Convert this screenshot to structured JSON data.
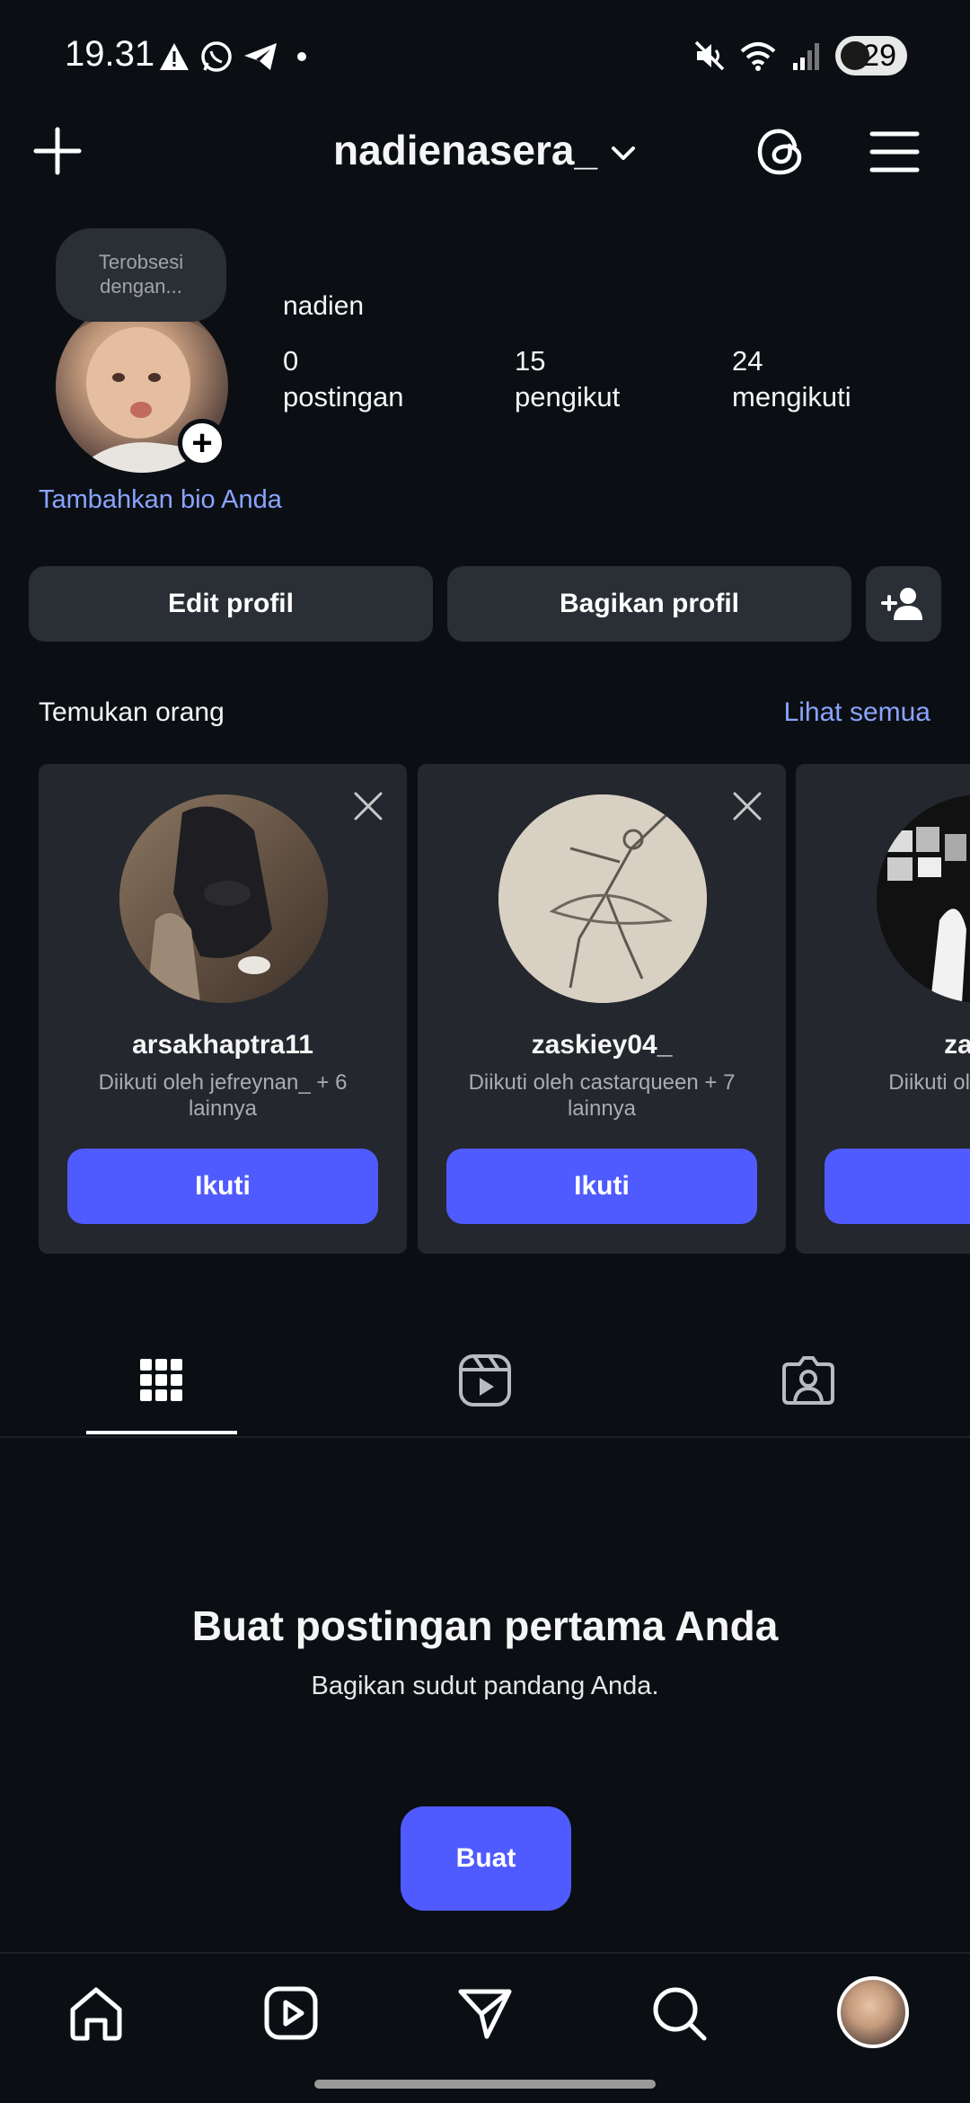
{
  "status_bar": {
    "time": "19.31",
    "battery": "29",
    "left_icons": [
      "warning-icon",
      "whatsapp-icon",
      "telegram-icon",
      "dot-icon"
    ],
    "right_icons": [
      "mute-icon",
      "wifi-icon",
      "signal-icon"
    ]
  },
  "header": {
    "username": "nadienasera_"
  },
  "profile": {
    "note": "Terobsesi dengan...",
    "display_name": "nadien",
    "stats": [
      {
        "value": "0",
        "label": "postingan"
      },
      {
        "value": "15",
        "label": "pengikut"
      },
      {
        "value": "24",
        "label": "mengikuti"
      }
    ],
    "add_bio": "Tambahkan bio Anda"
  },
  "actions": {
    "edit": "Edit profil",
    "share": "Bagikan profil"
  },
  "discover": {
    "title": "Temukan orang",
    "see_all": "Lihat semua",
    "cards": [
      {
        "name": "arsakhaptra11",
        "followed_by": "Diikuti oleh jefreynan_ + 6 lainnya",
        "button": "Ikuti"
      },
      {
        "name": "zaskiey04_",
        "followed_by": "Diikuti oleh castarqueen + 7 lainnya",
        "button": "Ikuti"
      },
      {
        "name": "zassk",
        "followed_by": "Diikuti oleh ca lain",
        "button": "Ik"
      }
    ]
  },
  "tabs": [
    "grid-icon",
    "reels-icon",
    "tagged-icon"
  ],
  "empty_state": {
    "title": "Buat postingan pertama Anda",
    "subtitle": "Bagikan sudut pandang Anda.",
    "button": "Buat"
  },
  "bottom_nav": [
    "home-icon",
    "reels-icon",
    "direct-icon",
    "search-icon",
    "profile-avatar"
  ],
  "colors": {
    "background": "#0b0f14",
    "accent_blue": "#4f5bff",
    "link_blue": "#8aa4ff",
    "surface": "#2a2e35"
  }
}
